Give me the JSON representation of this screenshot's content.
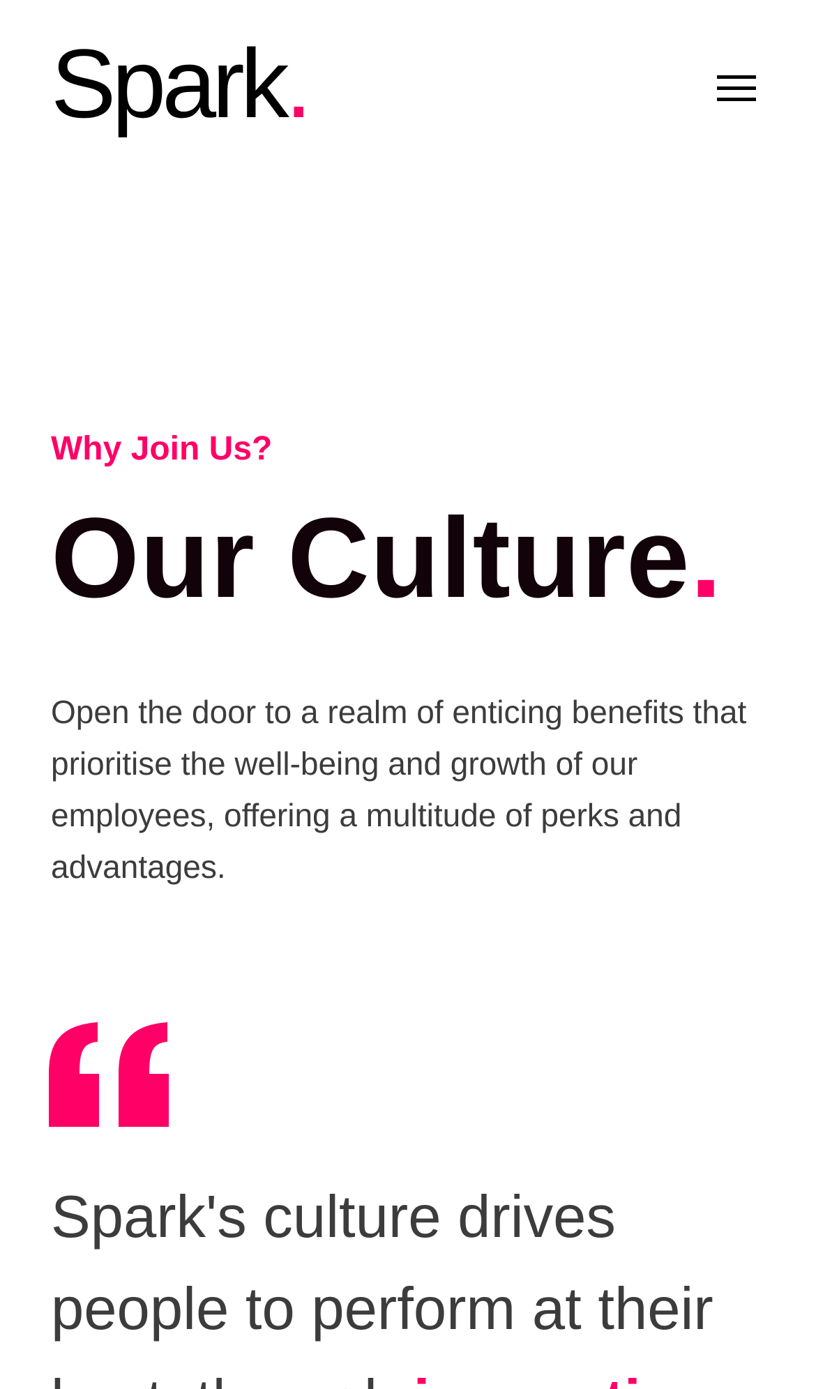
{
  "header": {
    "logo_text": "Spark",
    "logo_dot": ".",
    "menu_icon": "hamburger-menu-icon"
  },
  "culture": {
    "eyebrow": "Why Join Us?",
    "title": "Our Culture",
    "title_dot": ".",
    "intro": "Open the door to a realm of enticing benefits that prioritise the well-being and growth of our employees, offering a multitude of perks and advantages."
  },
  "quote": {
    "icon": "quote-mark-icon",
    "text_before": "Spark's culture drives people to perform at their best, through ",
    "highlight": "innovation",
    "text_after": ","
  },
  "colors": {
    "accent": "#ff0066",
    "heading": "#12020a",
    "body_text": "#3c3c3c",
    "background": "#ffffff"
  }
}
